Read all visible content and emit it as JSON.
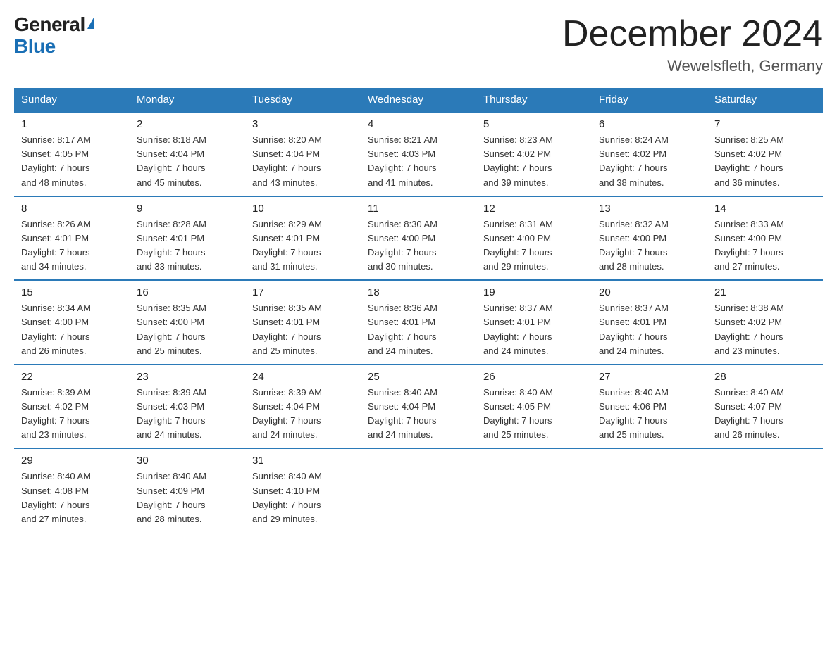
{
  "logo": {
    "general": "General",
    "blue": "Blue"
  },
  "title": "December 2024",
  "location": "Wewelsfleth, Germany",
  "days_of_week": [
    "Sunday",
    "Monday",
    "Tuesday",
    "Wednesday",
    "Thursday",
    "Friday",
    "Saturday"
  ],
  "weeks": [
    [
      {
        "day": "1",
        "info": "Sunrise: 8:17 AM\nSunset: 4:05 PM\nDaylight: 7 hours\nand 48 minutes."
      },
      {
        "day": "2",
        "info": "Sunrise: 8:18 AM\nSunset: 4:04 PM\nDaylight: 7 hours\nand 45 minutes."
      },
      {
        "day": "3",
        "info": "Sunrise: 8:20 AM\nSunset: 4:04 PM\nDaylight: 7 hours\nand 43 minutes."
      },
      {
        "day": "4",
        "info": "Sunrise: 8:21 AM\nSunset: 4:03 PM\nDaylight: 7 hours\nand 41 minutes."
      },
      {
        "day": "5",
        "info": "Sunrise: 8:23 AM\nSunset: 4:02 PM\nDaylight: 7 hours\nand 39 minutes."
      },
      {
        "day": "6",
        "info": "Sunrise: 8:24 AM\nSunset: 4:02 PM\nDaylight: 7 hours\nand 38 minutes."
      },
      {
        "day": "7",
        "info": "Sunrise: 8:25 AM\nSunset: 4:02 PM\nDaylight: 7 hours\nand 36 minutes."
      }
    ],
    [
      {
        "day": "8",
        "info": "Sunrise: 8:26 AM\nSunset: 4:01 PM\nDaylight: 7 hours\nand 34 minutes."
      },
      {
        "day": "9",
        "info": "Sunrise: 8:28 AM\nSunset: 4:01 PM\nDaylight: 7 hours\nand 33 minutes."
      },
      {
        "day": "10",
        "info": "Sunrise: 8:29 AM\nSunset: 4:01 PM\nDaylight: 7 hours\nand 31 minutes."
      },
      {
        "day": "11",
        "info": "Sunrise: 8:30 AM\nSunset: 4:00 PM\nDaylight: 7 hours\nand 30 minutes."
      },
      {
        "day": "12",
        "info": "Sunrise: 8:31 AM\nSunset: 4:00 PM\nDaylight: 7 hours\nand 29 minutes."
      },
      {
        "day": "13",
        "info": "Sunrise: 8:32 AM\nSunset: 4:00 PM\nDaylight: 7 hours\nand 28 minutes."
      },
      {
        "day": "14",
        "info": "Sunrise: 8:33 AM\nSunset: 4:00 PM\nDaylight: 7 hours\nand 27 minutes."
      }
    ],
    [
      {
        "day": "15",
        "info": "Sunrise: 8:34 AM\nSunset: 4:00 PM\nDaylight: 7 hours\nand 26 minutes."
      },
      {
        "day": "16",
        "info": "Sunrise: 8:35 AM\nSunset: 4:00 PM\nDaylight: 7 hours\nand 25 minutes."
      },
      {
        "day": "17",
        "info": "Sunrise: 8:35 AM\nSunset: 4:01 PM\nDaylight: 7 hours\nand 25 minutes."
      },
      {
        "day": "18",
        "info": "Sunrise: 8:36 AM\nSunset: 4:01 PM\nDaylight: 7 hours\nand 24 minutes."
      },
      {
        "day": "19",
        "info": "Sunrise: 8:37 AM\nSunset: 4:01 PM\nDaylight: 7 hours\nand 24 minutes."
      },
      {
        "day": "20",
        "info": "Sunrise: 8:37 AM\nSunset: 4:01 PM\nDaylight: 7 hours\nand 24 minutes."
      },
      {
        "day": "21",
        "info": "Sunrise: 8:38 AM\nSunset: 4:02 PM\nDaylight: 7 hours\nand 23 minutes."
      }
    ],
    [
      {
        "day": "22",
        "info": "Sunrise: 8:39 AM\nSunset: 4:02 PM\nDaylight: 7 hours\nand 23 minutes."
      },
      {
        "day": "23",
        "info": "Sunrise: 8:39 AM\nSunset: 4:03 PM\nDaylight: 7 hours\nand 24 minutes."
      },
      {
        "day": "24",
        "info": "Sunrise: 8:39 AM\nSunset: 4:04 PM\nDaylight: 7 hours\nand 24 minutes."
      },
      {
        "day": "25",
        "info": "Sunrise: 8:40 AM\nSunset: 4:04 PM\nDaylight: 7 hours\nand 24 minutes."
      },
      {
        "day": "26",
        "info": "Sunrise: 8:40 AM\nSunset: 4:05 PM\nDaylight: 7 hours\nand 25 minutes."
      },
      {
        "day": "27",
        "info": "Sunrise: 8:40 AM\nSunset: 4:06 PM\nDaylight: 7 hours\nand 25 minutes."
      },
      {
        "day": "28",
        "info": "Sunrise: 8:40 AM\nSunset: 4:07 PM\nDaylight: 7 hours\nand 26 minutes."
      }
    ],
    [
      {
        "day": "29",
        "info": "Sunrise: 8:40 AM\nSunset: 4:08 PM\nDaylight: 7 hours\nand 27 minutes."
      },
      {
        "day": "30",
        "info": "Sunrise: 8:40 AM\nSunset: 4:09 PM\nDaylight: 7 hours\nand 28 minutes."
      },
      {
        "day": "31",
        "info": "Sunrise: 8:40 AM\nSunset: 4:10 PM\nDaylight: 7 hours\nand 29 minutes."
      },
      {
        "day": "",
        "info": ""
      },
      {
        "day": "",
        "info": ""
      },
      {
        "day": "",
        "info": ""
      },
      {
        "day": "",
        "info": ""
      }
    ]
  ]
}
